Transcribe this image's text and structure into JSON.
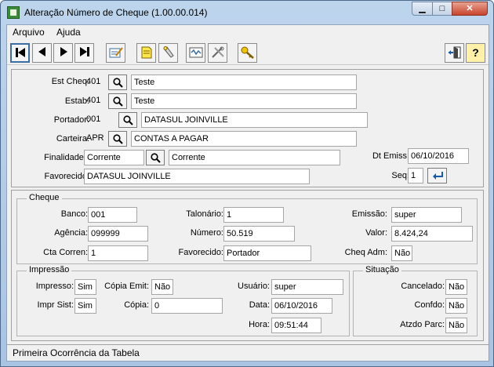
{
  "window": {
    "title": "Alteração Número de Cheque (1.00.00.014)",
    "min_glyph": "▁",
    "max_glyph": "□",
    "close_glyph": "✕"
  },
  "menu": {
    "arquivo": "Arquivo",
    "ajuda": "Ajuda"
  },
  "toolbar": {
    "first_icon": "first-record-icon",
    "prev_icon": "previous-record-icon",
    "next_icon": "next-record-icon",
    "last_icon": "last-record-icon",
    "help_glyph": "?"
  },
  "header": {
    "est_cheq": {
      "label": "Est Cheq:",
      "code": "401",
      "name": "Teste"
    },
    "estab": {
      "label": "Estab:",
      "code": "401",
      "name": "Teste"
    },
    "portador": {
      "label": "Portador:",
      "code": "001",
      "name": "DATASUL JOINVILLE"
    },
    "carteira": {
      "label": "Carteira:",
      "code": "APR",
      "name": "CONTAS A PAGAR"
    },
    "finalidade": {
      "label": "Finalidade:",
      "value": "Corrente",
      "desc": "Corrente"
    },
    "favorecido": {
      "label": "Favorecido:",
      "value": "DATASUL JOINVILLE"
    },
    "dt_emiss": {
      "label": "Dt Emiss:",
      "value": "06/10/2016"
    },
    "seq": {
      "label": "Seq:",
      "value": "1"
    }
  },
  "cheque": {
    "title": "Cheque",
    "banco": {
      "label": "Banco:",
      "value": "001"
    },
    "agencia": {
      "label": "Agência:",
      "value": "099999"
    },
    "cta_corren": {
      "label": "Cta Corren:",
      "value": "1"
    },
    "talonario": {
      "label": "Talonário:",
      "value": "1"
    },
    "numero": {
      "label": "Número:",
      "value": "50.519"
    },
    "favorecido": {
      "label": "Favorecido:",
      "value": "Portador"
    },
    "emissao": {
      "label": "Emissão:",
      "value": "super"
    },
    "valor": {
      "label": "Valor:",
      "value": "8.424,24"
    },
    "cheq_adm": {
      "label": "Cheq Adm:",
      "value": "Não"
    }
  },
  "impressao": {
    "title": "Impressão",
    "impresso": {
      "label": "Impresso:",
      "value": "Sim"
    },
    "impr_sist": {
      "label": "Impr Sist:",
      "value": "Sim"
    },
    "copia_emit": {
      "label": "Cópia Emit:",
      "value": "Não"
    },
    "copia": {
      "label": "Cópia:",
      "value": "0"
    },
    "usuario": {
      "label": "Usuário:",
      "value": "super"
    },
    "data": {
      "label": "Data:",
      "value": "06/10/2016"
    },
    "hora": {
      "label": "Hora:",
      "value": "09:51:44"
    }
  },
  "situacao": {
    "title": "Situação",
    "cancelado": {
      "label": "Cancelado:",
      "value": "Não"
    },
    "confdo": {
      "label": "Confdo:",
      "value": "Não"
    },
    "atzdo_parc": {
      "label": "Atzdo Parc:",
      "value": "Não"
    }
  },
  "status": {
    "text": "Primeira Ocorrência da Tabela"
  }
}
